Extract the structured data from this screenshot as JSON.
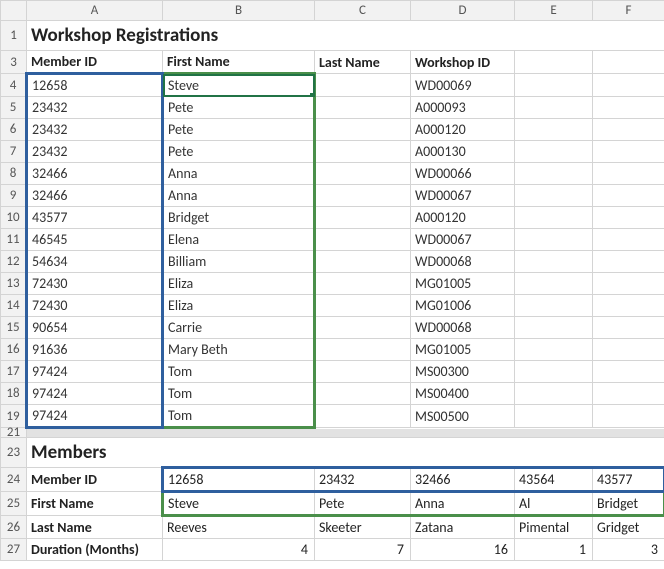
{
  "columns": [
    "A",
    "B",
    "C",
    "D",
    "E",
    "F"
  ],
  "title1": "Workshop Registrations",
  "reg_headers": {
    "a": "Member ID",
    "b": "First Name",
    "c": "Last Name",
    "d": "Workshop ID"
  },
  "reg_rows": [
    {
      "id": "12658",
      "first": "Steve",
      "last": "",
      "wid": "WD00069"
    },
    {
      "id": "23432",
      "first": "Pete",
      "last": "",
      "wid": "A000093"
    },
    {
      "id": "23432",
      "first": "Pete",
      "last": "",
      "wid": "A000120"
    },
    {
      "id": "23432",
      "first": "Pete",
      "last": "",
      "wid": "A000130"
    },
    {
      "id": "32466",
      "first": "Anna",
      "last": "",
      "wid": "WD00066"
    },
    {
      "id": "32466",
      "first": "Anna",
      "last": "",
      "wid": "WD00067"
    },
    {
      "id": "43577",
      "first": "Bridget",
      "last": "",
      "wid": "A000120"
    },
    {
      "id": "46545",
      "first": "Elena",
      "last": "",
      "wid": "WD00067"
    },
    {
      "id": "54634",
      "first": "Billiam",
      "last": "",
      "wid": "WD00068"
    },
    {
      "id": "72430",
      "first": "Eliza",
      "last": "",
      "wid": "MG01005"
    },
    {
      "id": "72430",
      "first": "Eliza",
      "last": "",
      "wid": "MG01006"
    },
    {
      "id": "90654",
      "first": "Carrie",
      "last": "",
      "wid": "WD00068"
    },
    {
      "id": "91636",
      "first": "Mary Beth",
      "last": "",
      "wid": "MG01005"
    },
    {
      "id": "97424",
      "first": "Tom",
      "last": "",
      "wid": "MS00300"
    },
    {
      "id": "97424",
      "first": "Tom",
      "last": "",
      "wid": "MS00400"
    },
    {
      "id": "97424",
      "first": "Tom",
      "last": "",
      "wid": "MS00500"
    }
  ],
  "title2": "Members",
  "mem_labels": {
    "id": "Member ID",
    "first": "First Name",
    "last": "Last Name",
    "dur": "Duration (Months)"
  },
  "mem_data": {
    "ids": [
      "12658",
      "23432",
      "32466",
      "43564",
      "43577"
    ],
    "firsts": [
      "Steve",
      "Pete",
      "Anna",
      "Al",
      "Bridget"
    ],
    "lasts": [
      "Reeves",
      "Skeeter",
      "Zatana",
      "Pimental",
      "Gridget"
    ],
    "durations": [
      "4",
      "7",
      "16",
      "1",
      "3"
    ]
  },
  "row_labels_top": [
    "1",
    "3",
    "4",
    "5",
    "6",
    "7",
    "8",
    "9",
    "10",
    "11",
    "12",
    "13",
    "14",
    "15",
    "16",
    "17",
    "18",
    "19"
  ],
  "row_label_gap": "21",
  "row_labels_bot": [
    "23",
    "24",
    "25",
    "26",
    "27"
  ]
}
